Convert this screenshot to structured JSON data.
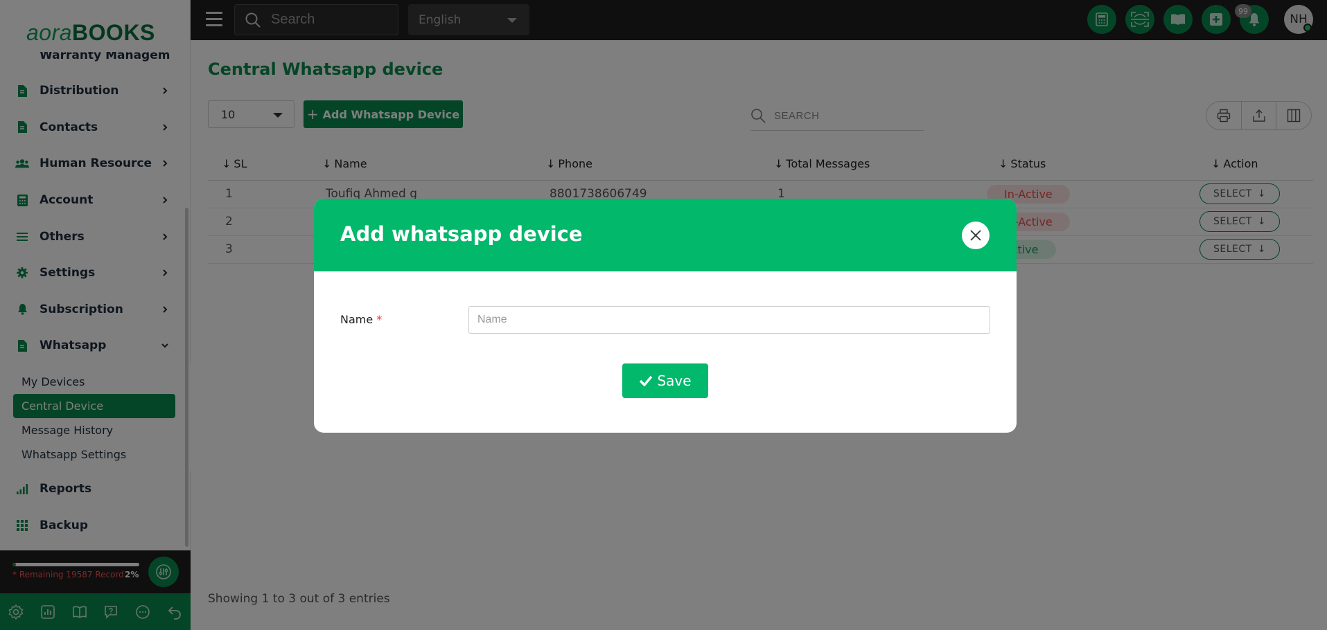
{
  "brand": {
    "logo_part1": "aora",
    "logo_part2": "BOOKS"
  },
  "sidebar": {
    "cut_item": "Warranty Managem",
    "items": [
      {
        "label": "Distribution",
        "icon": "document-icon"
      },
      {
        "label": "Contacts",
        "icon": "document-icon"
      },
      {
        "label": "Human Resource",
        "icon": "users-icon"
      },
      {
        "label": "Account",
        "icon": "calculator-icon"
      },
      {
        "label": "Others",
        "icon": "list-icon"
      },
      {
        "label": "Settings",
        "icon": "gear-icon"
      },
      {
        "label": "Subscription",
        "icon": "bell-icon"
      },
      {
        "label": "Whatsapp",
        "icon": "document-icon"
      }
    ],
    "whatsapp_sub": [
      {
        "label": "My Devices",
        "active": false
      },
      {
        "label": "Central Device",
        "active": true
      },
      {
        "label": "Message History",
        "active": false
      },
      {
        "label": "Whatsapp Settings",
        "active": false
      }
    ],
    "after_items": [
      {
        "label": "Reports",
        "icon": "bar-chart-icon"
      },
      {
        "label": "Backup",
        "icon": "grid-icon"
      }
    ],
    "usage": {
      "remaining_text": "* Remaining 19587 Record",
      "percent_text": "2%",
      "percent": 2
    }
  },
  "topbar": {
    "search_placeholder": "Search",
    "language": "English",
    "notification_count": "99",
    "avatar_initials": "NH"
  },
  "page": {
    "title": "Central Whatsapp device",
    "per_page": "10",
    "add_button": "Add Whatsapp Device",
    "search_placeholder": "SEARCH",
    "columns": [
      "SL",
      "Name",
      "Phone",
      "Total Messages",
      "Status",
      "Action"
    ],
    "rows": [
      {
        "sl": "1",
        "name": "Toufiq Ahmed g",
        "phone": "8801738606749",
        "total": "1",
        "status": "In-Active",
        "action": "SELECT"
      },
      {
        "sl": "2",
        "name": "",
        "phone": "",
        "total": "",
        "status": "In-Active",
        "action": "SELECT"
      },
      {
        "sl": "3",
        "name": "",
        "phone": "",
        "total": "",
        "status": "Active",
        "action": "SELECT"
      }
    ],
    "entries": "Showing 1 to 3 out of 3 entries"
  },
  "modal": {
    "title": "Add whatsapp device",
    "name_label": "Name",
    "required_mark": "*",
    "name_placeholder": "Name",
    "save_label": "Save"
  },
  "colors": {
    "brand_green": "#0b8a4f",
    "modal_green": "#02b86b",
    "inactive_red": "#e74c4c"
  }
}
